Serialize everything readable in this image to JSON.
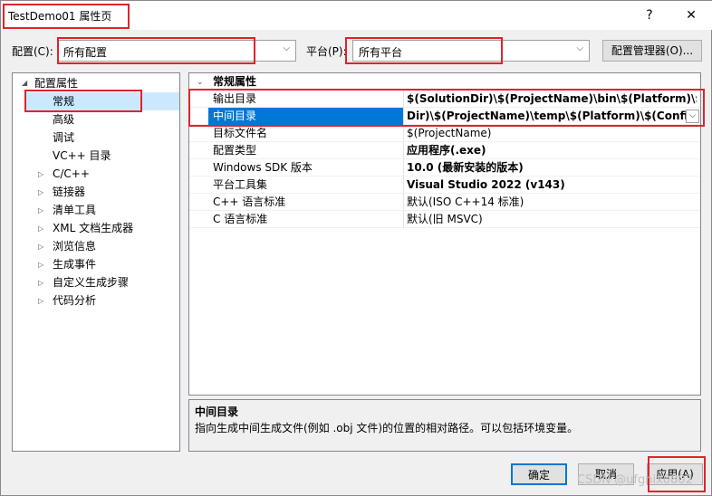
{
  "window": {
    "title": "TestDemo01 属性页",
    "help_label": "?",
    "close_label": "✕"
  },
  "toolbar": {
    "config_label": "配置(C):",
    "config_value": "所有配置",
    "platform_label": "平台(P):",
    "platform_value": "所有平台",
    "config_manager_label": "配置管理器(O)..."
  },
  "tree": {
    "root_label": "配置属性",
    "items": [
      {
        "label": "常规",
        "selected": true
      },
      {
        "label": "高级"
      },
      {
        "label": "调试"
      },
      {
        "label": "VC++ 目录"
      },
      {
        "label": "C/C++",
        "expandable": true
      },
      {
        "label": "链接器",
        "expandable": true
      },
      {
        "label": "清单工具",
        "expandable": true
      },
      {
        "label": "XML 文档生成器",
        "expandable": true
      },
      {
        "label": "浏览信息",
        "expandable": true
      },
      {
        "label": "生成事件",
        "expandable": true
      },
      {
        "label": "自定义生成步骤",
        "expandable": true
      },
      {
        "label": "代码分析",
        "expandable": true
      }
    ]
  },
  "grid": {
    "section_title": "常规属性",
    "rows": [
      {
        "name": "输出目录",
        "value": "$(SolutionDir)\\$(ProjectName)\\bin\\$(Platform)\\$(Co",
        "bold": true
      },
      {
        "name": "中间目录",
        "value": "Dir)\\$(ProjectName)\\temp\\$(Platform)\\$(Configur",
        "bold": true,
        "selected": true
      },
      {
        "name": "目标文件名",
        "value": "$(ProjectName)",
        "bold": false
      },
      {
        "name": "配置类型",
        "value": "应用程序(.exe)",
        "bold": true
      },
      {
        "name": "Windows SDK 版本",
        "value": "10.0 (最新安装的版本)",
        "bold": true
      },
      {
        "name": "平台工具集",
        "value": "Visual Studio 2022 (v143)",
        "bold": true
      },
      {
        "name": "C++ 语言标准",
        "value": "默认(ISO C++14 标准)",
        "bold": false
      },
      {
        "name": "C 语言标准",
        "value": "默认(旧 MSVC)",
        "bold": false
      }
    ]
  },
  "description": {
    "title": "中间目录",
    "text": "指向生成中间生成文件(例如 .obj 文件)的位置的相对路径。可以包括环境变量。"
  },
  "buttons": {
    "ok": "确定",
    "cancel": "取消",
    "apply": "应用(A)"
  },
  "watermark": "CSDN @ufgnix0802",
  "colors": {
    "highlight": "#0078d7",
    "tree_selected": "#cce8ff",
    "annotation_red": "#e0232b"
  }
}
